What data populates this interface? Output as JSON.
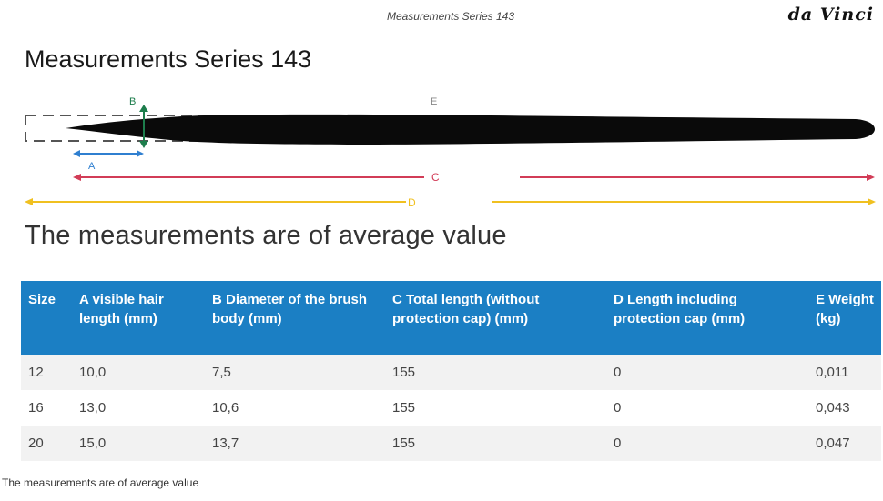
{
  "header": {
    "title": "Measurements Series 143",
    "brand": "da Vinci"
  },
  "page_title": "Measurements Series 143",
  "diagram": {
    "labels": {
      "a": "A",
      "b": "B",
      "c": "C",
      "d": "D",
      "e": "E"
    }
  },
  "subtitle": "The measurements are of average value",
  "table": {
    "headers": [
      "Size",
      "A visible hair length (mm)",
      "B Diameter of the brush body (mm)",
      "C Total length (without protection cap) (mm)",
      "D Length including protection cap (mm)",
      "E Weight (kg)"
    ],
    "rows": [
      [
        "12",
        "10,0",
        "7,5",
        "155",
        "0",
        "0,011"
      ],
      [
        "16",
        "13,0",
        "10,6",
        "155",
        "0",
        "0,043"
      ],
      [
        "20",
        "15,0",
        "13,7",
        "155",
        "0",
        "0,047"
      ]
    ]
  },
  "footnote": "The measurements are of average value",
  "colors": {
    "header_bg": "#1b7fc4",
    "arrow_a": "#2f7fd0",
    "arrow_b": "#1d7d4c",
    "arrow_c": "#d23c57",
    "arrow_d": "#f0c020"
  }
}
